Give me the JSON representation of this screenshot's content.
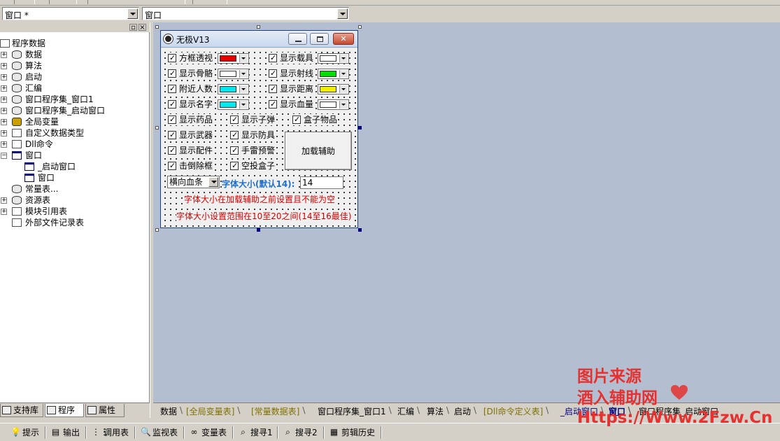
{
  "combos": {
    "left_value": "窗口 *",
    "right_value": "窗口"
  },
  "tree": [
    {
      "label": "程序数据",
      "icon": "program-data-icon"
    },
    {
      "label": "数据",
      "icon": "database-icon"
    },
    {
      "label": "算法",
      "icon": "database-icon"
    },
    {
      "label": "启动",
      "icon": "database-icon"
    },
    {
      "label": "汇编",
      "icon": "database-icon"
    },
    {
      "label": "窗口程序集_窗口1",
      "icon": "database-icon"
    },
    {
      "label": "窗口程序集_启动窗口",
      "icon": "database-icon"
    },
    {
      "label": "全局变量",
      "icon": "global-variable-icon"
    },
    {
      "label": "自定义数据类型",
      "icon": "custom-type-icon"
    },
    {
      "label": "Dll命令",
      "icon": "dll-command-icon"
    },
    {
      "label": "窗口",
      "icon": "window-icon"
    },
    {
      "label": "_启动窗口",
      "icon": "window-icon"
    },
    {
      "label": "窗口",
      "icon": "window-icon"
    },
    {
      "label": "常量表...",
      "icon": "constant-table-icon"
    },
    {
      "label": "资源表",
      "icon": "resource-table-icon"
    },
    {
      "label": "模块引用表",
      "icon": "module-reference-icon"
    },
    {
      "label": "外部文件记录表",
      "icon": "external-file-icon"
    }
  ],
  "left_tabs": [
    "支持库",
    "程序",
    "属性"
  ],
  "form": {
    "title": "无极V13",
    "checks": {
      "box_esp": "方框透视",
      "show_vehicle": "显示载具",
      "show_skeleton": "显示骨骼",
      "show_ray": "显示射线",
      "nearby_count": "附近人数",
      "show_distance": "显示距离",
      "show_name": "显示名字",
      "show_health": "显示血量",
      "show_medicine": "显示药品",
      "show_bullet": "显示子弹",
      "box_items": "盒子物品",
      "show_weapon": "显示武器",
      "show_armor": "显示防具",
      "show_attachment": "显示配件",
      "grenade_warning": "手雷预警",
      "knockdown_box": "击倒除框",
      "airdrop_box": "空投盒子"
    },
    "colors": {
      "box_esp": "#e80000",
      "show_vehicle": "#ffffff",
      "show_skeleton": "#ffffff",
      "show_ray": "#00e000",
      "nearby_count": "#00e8f0",
      "show_distance": "#f0f000",
      "show_name": "#00e8f0",
      "show_health": "#ffffff"
    },
    "load_button": "加载辅助",
    "health_bar_select": "横向血条",
    "font_size_label": "字体大小(默认14):",
    "font_size_value": "14",
    "note1": "字体大小在加载辅助之前设置且不能为空",
    "note2": "字体大小设置范围在10至20之间(14至16最佳)"
  },
  "doc_tabs": [
    "数据",
    "[全局变量表]",
    "[常量数据表]",
    "窗口程序集_窗口1",
    "汇编",
    "算法",
    "启动",
    "[Dll命令定义表]",
    "_启动窗口",
    "窗口",
    "窗口程序集_启动窗口"
  ],
  "bottom_buttons": [
    "提示",
    "输出",
    "调用表",
    "监视表",
    "变量表",
    "搜寻1",
    "搜寻2",
    "剪辑历史"
  ],
  "watermark": {
    "line1": "图片来源",
    "line2": "酒入辅助网",
    "line3": "Https://Www.2Fzw.Cn",
    "color": "#e5312f"
  }
}
